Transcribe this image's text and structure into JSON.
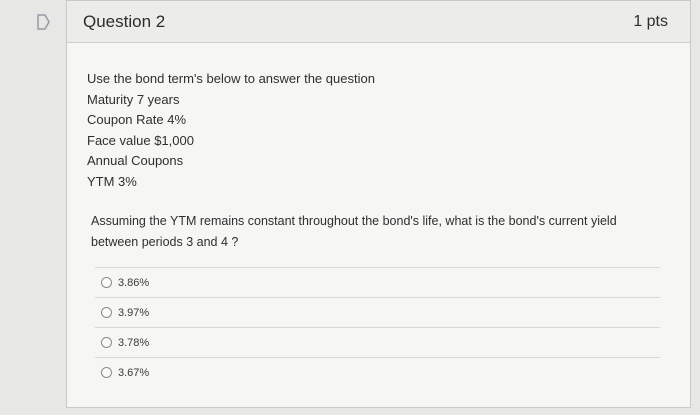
{
  "question": {
    "title": "Question 2",
    "points": "1 pts",
    "lines": [
      "Use the bond term's below to answer the question",
      "Maturity 7 years",
      "Coupon Rate 4%",
      "Face value $1,000",
      "Annual Coupons",
      "YTM 3%"
    ],
    "prompt_line1": "Assuming the YTM remains constant throughout the bond's life, what is the bond's current yield",
    "prompt_line2": "between periods 3 and 4 ?"
  },
  "answers": [
    {
      "label": "3.86%"
    },
    {
      "label": "3.97%"
    },
    {
      "label": "3.78%"
    },
    {
      "label": "3.67%"
    }
  ]
}
